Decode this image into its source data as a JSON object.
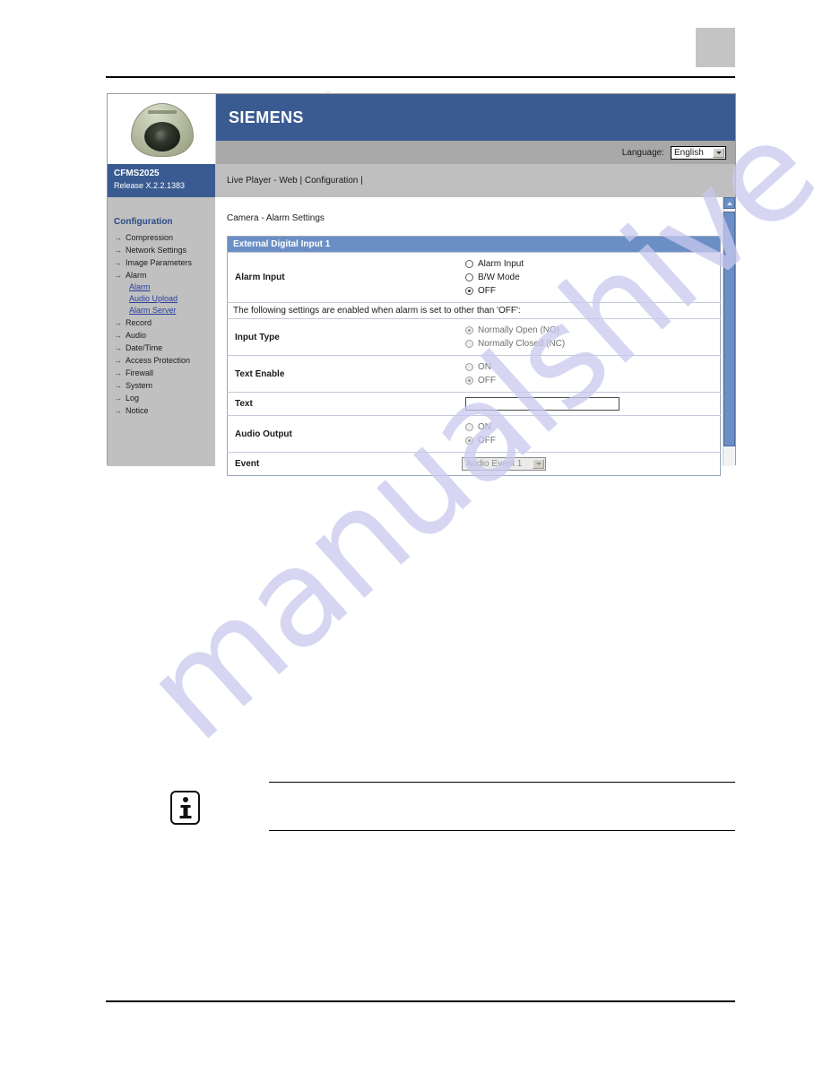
{
  "page": {
    "corner_box_present": true,
    "watermark_text": "manualshive",
    "tiny_mark": "...",
    "accent_blue": "#3a5b91",
    "section_header_blue": "#6b8fc4",
    "link_blue": "#2a3f9c",
    "sidebar_gray": "#c0c0c0",
    "nav_gray": "#bfbfbf",
    "language_bar_gray": "#a8a8a8"
  },
  "header": {
    "brand": "SIEMENS",
    "language_label": "Language:",
    "language_value": "English",
    "language_options": [
      "English"
    ]
  },
  "device": {
    "model": "CFMS2025",
    "release": "Release X.2.2.1383"
  },
  "nav": {
    "links_text": "Live Player - Web  | Configuration  |",
    "items": [
      "Live Player - Web",
      "Configuration"
    ]
  },
  "sidebar": {
    "heading": "Configuration",
    "items": [
      {
        "label": "Compression",
        "sub": []
      },
      {
        "label": "Network Settings",
        "sub": []
      },
      {
        "label": "Image Parameters",
        "sub": []
      },
      {
        "label": "Alarm",
        "sub": [
          "Alarm",
          "Audio Upload",
          "Alarm Server"
        ]
      },
      {
        "label": "Record",
        "sub": []
      },
      {
        "label": "Audio",
        "sub": []
      },
      {
        "label": "Date/Time",
        "sub": []
      },
      {
        "label": "Access Protection",
        "sub": []
      },
      {
        "label": "Firewall",
        "sub": []
      },
      {
        "label": "System",
        "sub": []
      },
      {
        "label": "Log",
        "sub": []
      },
      {
        "label": "Notice",
        "sub": []
      }
    ]
  },
  "content": {
    "title": "Camera - Alarm Settings",
    "section_header": "External Digital Input 1",
    "note": "The following settings are enabled when alarm is set to other than 'OFF':",
    "rows": {
      "alarm_input": {
        "label": "Alarm Input",
        "options": [
          {
            "label": "Alarm Input",
            "checked": false,
            "disabled": false
          },
          {
            "label": "B/W Mode",
            "checked": false,
            "disabled": false
          },
          {
            "label": "OFF",
            "checked": true,
            "disabled": false
          }
        ]
      },
      "input_type": {
        "label": "Input Type",
        "options": [
          {
            "label": "Normally Open (NO)",
            "checked": true,
            "disabled": true
          },
          {
            "label": "Normally Closed (NC)",
            "checked": false,
            "disabled": true
          }
        ]
      },
      "text_enable": {
        "label": "Text Enable",
        "options": [
          {
            "label": "ON",
            "checked": false,
            "disabled": true
          },
          {
            "label": "OFF",
            "checked": true,
            "disabled": true
          }
        ]
      },
      "text": {
        "label": "Text",
        "value": "",
        "placeholder": ""
      },
      "audio_output": {
        "label": "Audio Output",
        "options": [
          {
            "label": "ON",
            "checked": false,
            "disabled": true
          },
          {
            "label": "OFF",
            "checked": true,
            "disabled": true
          }
        ]
      },
      "event": {
        "label": "Event",
        "value": "Audio Event 1",
        "options": [
          "Audio Event 1"
        ]
      }
    }
  },
  "info_note": {
    "icon": "info-icon",
    "text": ""
  }
}
